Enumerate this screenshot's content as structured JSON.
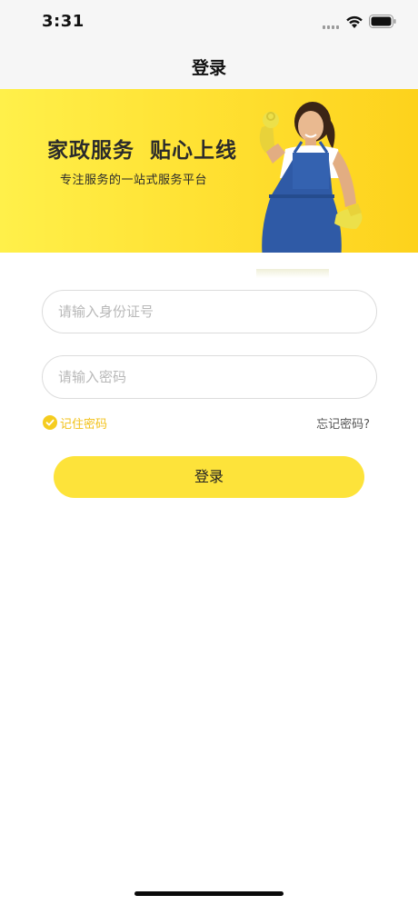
{
  "status_bar": {
    "time": "3:31"
  },
  "nav": {
    "title": "登录"
  },
  "banner": {
    "title": "家政服务  贴心上线",
    "subtitle": "专注服务的一站式服务平台"
  },
  "form": {
    "id_placeholder": "请输入身份证号",
    "id_value": "",
    "password_placeholder": "请输入密码",
    "password_value": "",
    "remember_label": "记住密码",
    "remember_checked": true,
    "forgot_label": "忘记密码?",
    "login_label": "登录"
  },
  "colors": {
    "accent": "#fde33a",
    "remember_text": "#f2c21a",
    "banner_start": "#fff04a",
    "banner_end": "#fdd21c"
  },
  "icons": {
    "signal": "cellular-signal-icon",
    "wifi": "wifi-icon",
    "battery": "battery-icon",
    "check": "check-circle-icon"
  }
}
